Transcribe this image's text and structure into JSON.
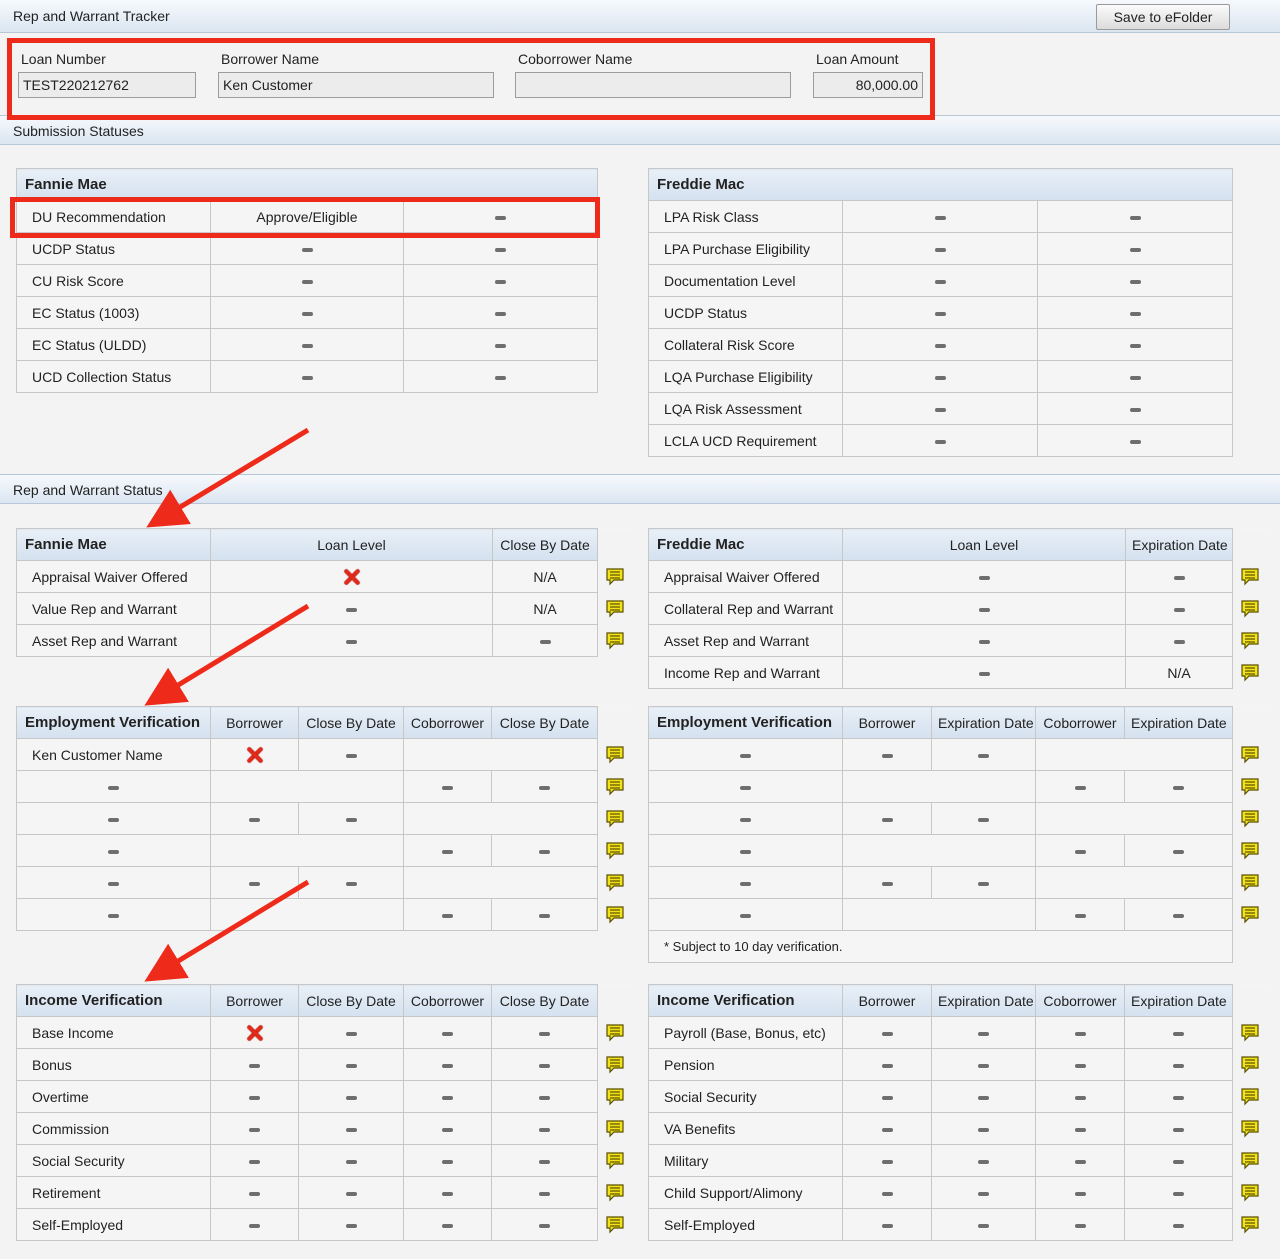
{
  "header": {
    "title": "Rep and Warrant Tracker",
    "save_label": "Save to eFolder"
  },
  "loan": {
    "loan_number_label": "Loan Number",
    "loan_number": "TEST220212762",
    "borrower_label": "Borrower Name",
    "borrower": "Ken Customer",
    "coborrower_label": "Coborrower Name",
    "coborrower": "",
    "amount_label": "Loan Amount",
    "amount": "80,000.00"
  },
  "sections": {
    "submission": "Submission Statuses",
    "rep_warrant": "Rep and Warrant Status"
  },
  "submission": {
    "fannie": {
      "title": "Fannie Mae",
      "rows": [
        {
          "label": "DU Recommendation",
          "v1": "Approve/Eligible",
          "v2": "-"
        },
        {
          "label": "UCDP Status",
          "v1": "-",
          "v2": "-"
        },
        {
          "label": "CU Risk Score",
          "v1": "-",
          "v2": "-"
        },
        {
          "label": "EC Status (1003)",
          "v1": "-",
          "v2": "-"
        },
        {
          "label": "EC Status (ULDD)",
          "v1": "-",
          "v2": "-"
        },
        {
          "label": "UCD Collection Status",
          "v1": "-",
          "v2": "-"
        }
      ]
    },
    "freddie": {
      "title": "Freddie Mac",
      "rows": [
        {
          "label": "LPA Risk Class",
          "v1": "-",
          "v2": "-"
        },
        {
          "label": "LPA Purchase Eligibility",
          "v1": "-",
          "v2": "-"
        },
        {
          "label": "Documentation Level",
          "v1": "-",
          "v2": "-"
        },
        {
          "label": "UCDP Status",
          "v1": "-",
          "v2": "-"
        },
        {
          "label": "Collateral Risk Score",
          "v1": "-",
          "v2": "-"
        },
        {
          "label": "LQA Purchase Eligibility",
          "v1": "-",
          "v2": "-"
        },
        {
          "label": "LQA Risk Assessment",
          "v1": "-",
          "v2": "-"
        },
        {
          "label": "LCLA UCD Requirement",
          "v1": "-",
          "v2": "-"
        }
      ]
    }
  },
  "rw": {
    "fannie": {
      "title": "Fannie Mae",
      "col1": "Loan Level",
      "col2": "Close By Date",
      "rows": [
        {
          "label": "Appraisal Waiver Offered",
          "level": "x",
          "date": "N/A"
        },
        {
          "label": "Value Rep and Warrant",
          "level": "-",
          "date": "N/A"
        },
        {
          "label": "Asset Rep and Warrant",
          "level": "-",
          "date": "-"
        }
      ]
    },
    "freddie": {
      "title": "Freddie Mac",
      "col1": "Loan Level",
      "col2": "Expiration Date",
      "rows": [
        {
          "label": "Appraisal Waiver Offered",
          "level": "-",
          "date": "-"
        },
        {
          "label": "Collateral Rep and Warrant",
          "level": "-",
          "date": "-"
        },
        {
          "label": "Asset Rep and Warrant",
          "level": "-",
          "date": "-"
        },
        {
          "label": "Income Rep and Warrant",
          "level": "-",
          "date": "N/A"
        }
      ]
    }
  },
  "employment": {
    "fannie": {
      "title": "Employment Verification",
      "cols": [
        "Borrower",
        "Close By Date",
        "Coborrower",
        "Close By Date"
      ],
      "rows": [
        [
          "Ken Customer Name",
          "x",
          "-",
          "",
          ""
        ],
        [
          "-",
          "",
          "",
          "-",
          "-"
        ],
        [
          "-",
          "-",
          "-",
          "",
          ""
        ],
        [
          "-",
          "",
          "",
          "-",
          "-"
        ],
        [
          "-",
          "-",
          "-",
          "",
          ""
        ],
        [
          "-",
          "",
          "",
          "-",
          "-"
        ]
      ]
    },
    "freddie": {
      "title": "Employment Verification",
      "cols": [
        "Borrower",
        "Expiration Date",
        "Coborrower",
        "Expiration Date"
      ],
      "rows": [
        [
          "-",
          "-",
          "-",
          "",
          ""
        ],
        [
          "-",
          "",
          "",
          "-",
          "-"
        ],
        [
          "-",
          "-",
          "-",
          "",
          ""
        ],
        [
          "-",
          "",
          "",
          "-",
          "-"
        ],
        [
          "-",
          "-",
          "-",
          "",
          ""
        ],
        [
          "-",
          "",
          "",
          "-",
          "-"
        ]
      ],
      "footnote": "* Subject to 10 day verification."
    }
  },
  "income": {
    "fannie": {
      "title": "Income Verification",
      "cols": [
        "Borrower",
        "Close By Date",
        "Coborrower",
        "Close By Date"
      ],
      "rows": [
        [
          "Base Income",
          "x",
          "-",
          "-",
          "-"
        ],
        [
          "Bonus",
          "-",
          "-",
          "-",
          "-"
        ],
        [
          "Overtime",
          "-",
          "-",
          "-",
          "-"
        ],
        [
          "Commission",
          "-",
          "-",
          "-",
          "-"
        ],
        [
          "Social Security",
          "-",
          "-",
          "-",
          "-"
        ],
        [
          "Retirement",
          "-",
          "-",
          "-",
          "-"
        ],
        [
          "Self-Employed",
          "-",
          "-",
          "-",
          "-"
        ]
      ]
    },
    "freddie": {
      "title": "Income Verification",
      "cols": [
        "Borrower",
        "Expiration Date",
        "Coborrower",
        "Expiration Date"
      ],
      "rows": [
        [
          "Payroll (Base, Bonus, etc)",
          "-",
          "-",
          "-",
          "-"
        ],
        [
          "Pension",
          "-",
          "-",
          "-",
          "-"
        ],
        [
          "Social Security",
          "-",
          "-",
          "-",
          "-"
        ],
        [
          "VA Benefits",
          "-",
          "-",
          "-",
          "-"
        ],
        [
          "Military",
          "-",
          "-",
          "-",
          "-"
        ],
        [
          "Child Support/Alimony",
          "-",
          "-",
          "-",
          "-"
        ],
        [
          "Self-Employed",
          "-",
          "-",
          "-",
          "-"
        ]
      ]
    }
  },
  "colors": {
    "annotation": "#ee2a1a",
    "fail": "#e02a1c",
    "comment": "#f2e21c"
  }
}
